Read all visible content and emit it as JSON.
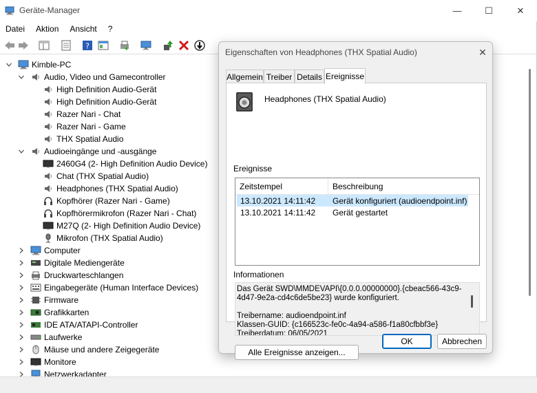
{
  "window": {
    "title": "Geräte-Manager",
    "controls": {
      "minimize": "—",
      "maximize": "☐",
      "close": "✕"
    }
  },
  "menu": [
    "Datei",
    "Aktion",
    "Ansicht",
    "?"
  ],
  "tree": {
    "root": "Kimble-PC",
    "items": [
      {
        "label": "Audio, Video und Gamecontroller",
        "level": 1,
        "expander": "v",
        "icon": "speaker-icon"
      },
      {
        "label": "High Definition Audio-Gerät",
        "level": 2,
        "expander": "",
        "icon": "speaker-icon"
      },
      {
        "label": "High Definition Audio-Gerät",
        "level": 2,
        "expander": "",
        "icon": "speaker-icon"
      },
      {
        "label": "Razer Nari - Chat",
        "level": 2,
        "expander": "",
        "icon": "speaker-icon"
      },
      {
        "label": "Razer Nari - Game",
        "level": 2,
        "expander": "",
        "icon": "speaker-icon"
      },
      {
        "label": "THX Spatial Audio",
        "level": 2,
        "expander": "",
        "icon": "speaker-icon"
      },
      {
        "label": "Audioeingänge und -ausgänge",
        "level": 1,
        "expander": "v",
        "icon": "speaker-icon"
      },
      {
        "label": "2460G4 (2- High Definition Audio Device)",
        "level": 2,
        "expander": "",
        "icon": "monitor-icon"
      },
      {
        "label": "Chat (THX Spatial Audio)",
        "level": 2,
        "expander": "",
        "icon": "speaker-icon"
      },
      {
        "label": "Headphones (THX Spatial Audio)",
        "level": 2,
        "expander": "",
        "icon": "speaker-icon"
      },
      {
        "label": "Kopfhörer (Razer Nari - Game)",
        "level": 2,
        "expander": "",
        "icon": "headphones-icon"
      },
      {
        "label": "Kopfhörermikrofon (Razer Nari - Chat)",
        "level": 2,
        "expander": "",
        "icon": "headphones-icon"
      },
      {
        "label": "M27Q (2- High Definition Audio Device)",
        "level": 2,
        "expander": "",
        "icon": "monitor-icon"
      },
      {
        "label": "Mikrofon (THX Spatial Audio)",
        "level": 2,
        "expander": "",
        "icon": "microphone-icon"
      },
      {
        "label": "Computer",
        "level": 1,
        "expander": ">",
        "icon": "computer-icon"
      },
      {
        "label": "Digitale Mediengeräte",
        "level": 1,
        "expander": ">",
        "icon": "media-device-icon"
      },
      {
        "label": "Druckwarteschlangen",
        "level": 1,
        "expander": ">",
        "icon": "printer-icon"
      },
      {
        "label": "Eingabegeräte (Human Interface Devices)",
        "level": 1,
        "expander": ">",
        "icon": "hid-icon"
      },
      {
        "label": "Firmware",
        "level": 1,
        "expander": ">",
        "icon": "firmware-icon"
      },
      {
        "label": "Grafikkarten",
        "level": 1,
        "expander": ">",
        "icon": "gpu-icon"
      },
      {
        "label": "IDE ATA/ATAPI-Controller",
        "level": 1,
        "expander": ">",
        "icon": "ide-controller-icon"
      },
      {
        "label": "Laufwerke",
        "level": 1,
        "expander": ">",
        "icon": "drive-icon"
      },
      {
        "label": "Mäuse und andere Zeigegeräte",
        "level": 1,
        "expander": ">",
        "icon": "mouse-icon"
      },
      {
        "label": "Monitore",
        "level": 1,
        "expander": ">",
        "icon": "monitor-icon"
      },
      {
        "label": "Netzwerkadapter",
        "level": 1,
        "expander": ">",
        "icon": "network-icon"
      }
    ]
  },
  "dialog": {
    "title": "Eigenschaften von Headphones (THX Spatial Audio)",
    "close": "✕",
    "tabs": [
      "Allgemein",
      "Treiber",
      "Details",
      "Ereignisse"
    ],
    "active_tab": "Ereignisse",
    "device_name": "Headphones (THX Spatial Audio)",
    "events_label": "Ereignisse",
    "columns": [
      "Zeitstempel",
      "Beschreibung"
    ],
    "events": [
      {
        "time": "13.10.2021 14:11:42",
        "desc": "Gerät konfiguriert (audioendpoint.inf)"
      },
      {
        "time": "13.10.2021 14:11:42",
        "desc": "Gerät gestartet"
      }
    ],
    "info_label": "Informationen",
    "info_lines": [
      "Das Gerät SWD\\MMDEVAPI\\{0.0.0.00000000}.{cbeac566-43c9-",
      "4d47-9e2a-cd4c6de5be23} wurde konfiguriert.",
      "",
      "Treibername: audioendpoint.inf",
      "Klassen-GUID: {c166523c-fe0c-4a94-a586-f1a80cfbbf3e}",
      "Treiberdatum: 06/05/2021"
    ],
    "all_events_button": "Alle Ereignisse anzeigen...",
    "ok_button": "OK",
    "cancel_button": "Abbrechen"
  },
  "colors": {
    "selection": "#cce8ff",
    "accent": "#0067c0",
    "dialog_bg": "#f0f0f0"
  }
}
